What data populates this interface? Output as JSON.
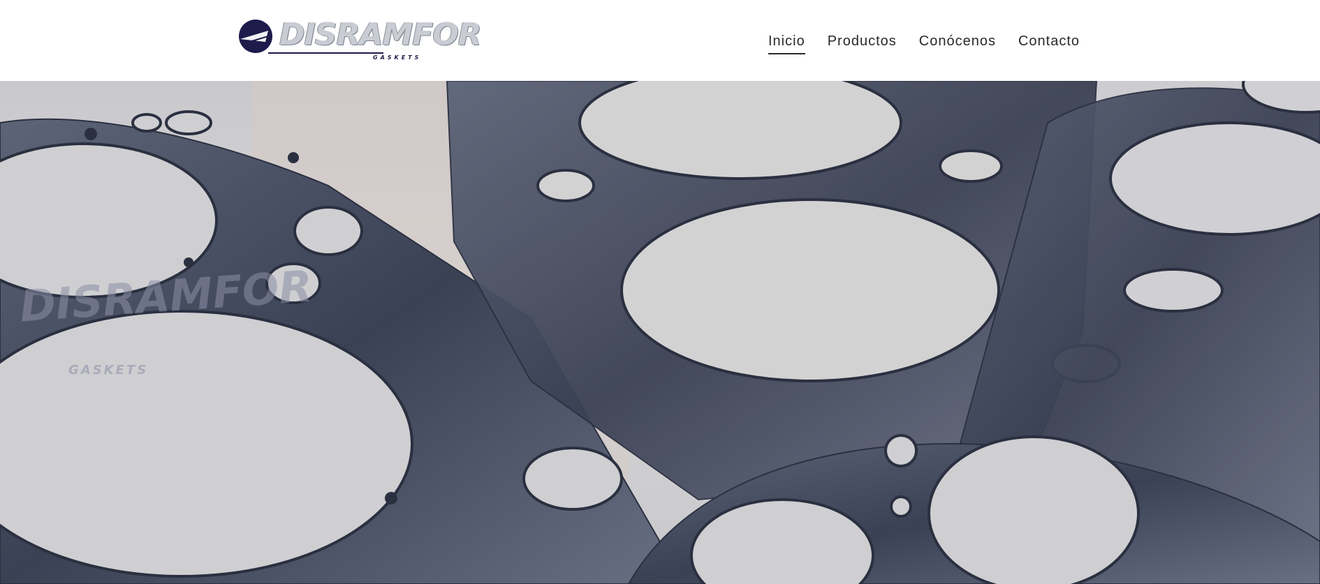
{
  "brand": {
    "name": "DISRAMFOR",
    "tagline": "GASKETS",
    "colors": {
      "primary": "#1e1b4b",
      "silver": "#c9ccd3"
    }
  },
  "nav": {
    "items": [
      {
        "label": "Inicio",
        "active": true
      },
      {
        "label": "Productos",
        "active": false
      },
      {
        "label": "Conócenos",
        "active": false
      },
      {
        "label": "Contacto",
        "active": false
      }
    ]
  },
  "hero": {
    "image": "head-gasket-photo",
    "overlay_text": "DISRAMFOR",
    "overlay_sub": "GASKETS"
  }
}
